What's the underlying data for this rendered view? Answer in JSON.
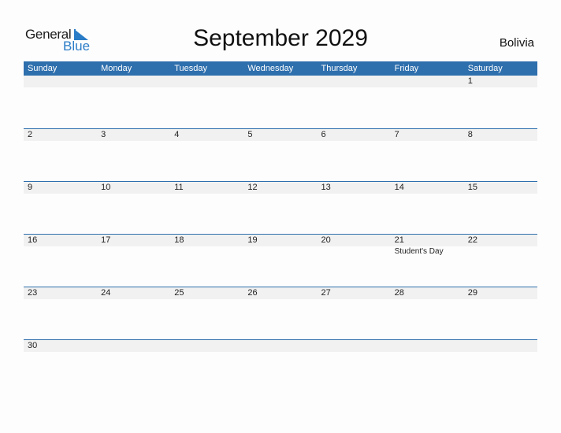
{
  "logo": {
    "general": "General",
    "blue": "Blue"
  },
  "title": "September 2029",
  "country": "Bolivia",
  "colors": {
    "header_bg": "#2e6fad",
    "band_bg": "#f1f1f1",
    "logo_blue": "#2a7cc7"
  },
  "days": [
    "Sunday",
    "Monday",
    "Tuesday",
    "Wednesday",
    "Thursday",
    "Friday",
    "Saturday"
  ],
  "weeks": [
    [
      {
        "d": ""
      },
      {
        "d": ""
      },
      {
        "d": ""
      },
      {
        "d": ""
      },
      {
        "d": ""
      },
      {
        "d": ""
      },
      {
        "d": "1"
      }
    ],
    [
      {
        "d": "2"
      },
      {
        "d": "3"
      },
      {
        "d": "4"
      },
      {
        "d": "5"
      },
      {
        "d": "6"
      },
      {
        "d": "7"
      },
      {
        "d": "8"
      }
    ],
    [
      {
        "d": "9"
      },
      {
        "d": "10"
      },
      {
        "d": "11"
      },
      {
        "d": "12"
      },
      {
        "d": "13"
      },
      {
        "d": "14"
      },
      {
        "d": "15"
      }
    ],
    [
      {
        "d": "16"
      },
      {
        "d": "17"
      },
      {
        "d": "18"
      },
      {
        "d": "19"
      },
      {
        "d": "20"
      },
      {
        "d": "21",
        "event": "Student's Day"
      },
      {
        "d": "22"
      }
    ],
    [
      {
        "d": "23"
      },
      {
        "d": "24"
      },
      {
        "d": "25"
      },
      {
        "d": "26"
      },
      {
        "d": "27"
      },
      {
        "d": "28"
      },
      {
        "d": "29"
      }
    ],
    [
      {
        "d": "30"
      },
      {
        "d": ""
      },
      {
        "d": ""
      },
      {
        "d": ""
      },
      {
        "d": ""
      },
      {
        "d": ""
      },
      {
        "d": ""
      }
    ]
  ]
}
